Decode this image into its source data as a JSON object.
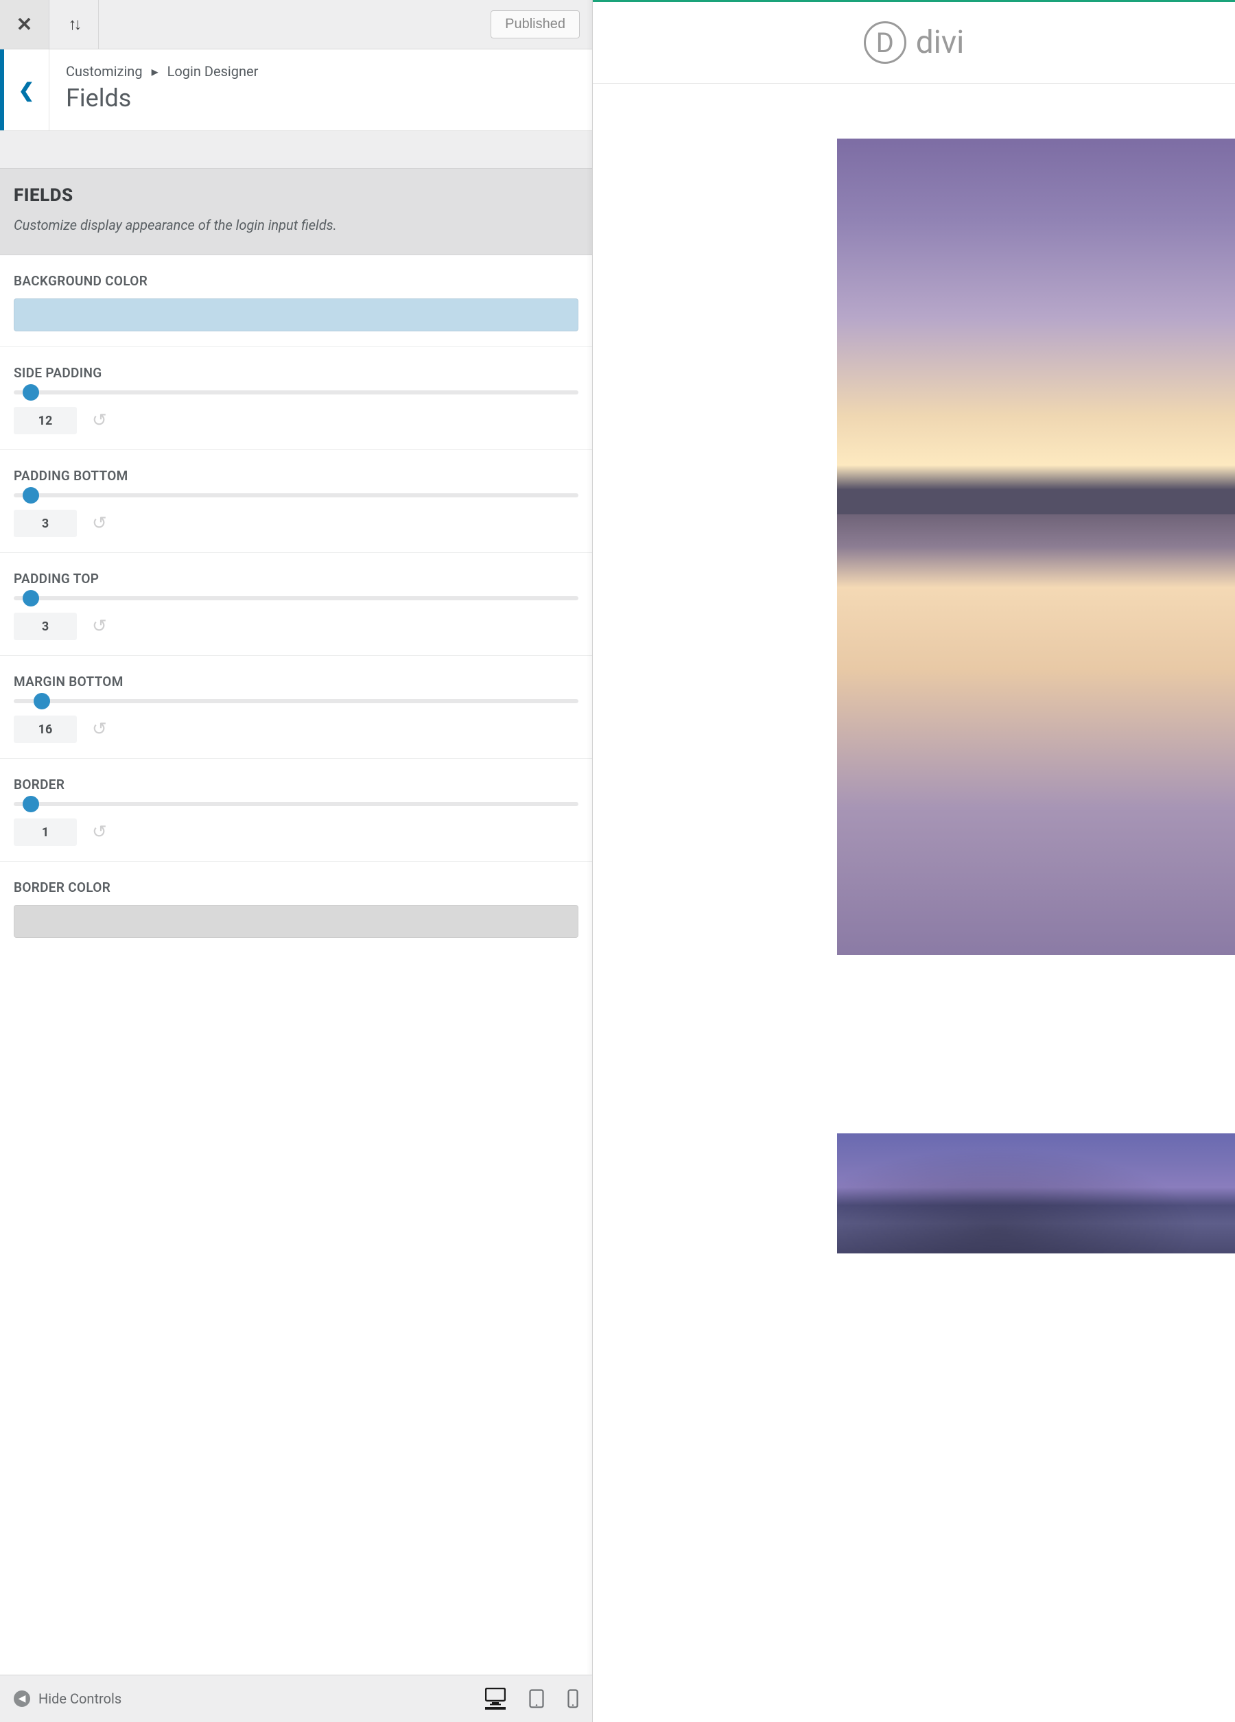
{
  "topbar": {
    "publish_label": "Published"
  },
  "header": {
    "crumb_root": "Customizing",
    "crumb_sep": "▸",
    "crumb_section": "Login Designer",
    "title": "Fields"
  },
  "description": {
    "heading": "FIELDS",
    "text": "Customize display appearance of the login input fields."
  },
  "controls": {
    "bg_color_label": "BACKGROUND COLOR",
    "bg_color_value": "#bfdaea",
    "side_padding_label": "SIDE PADDING",
    "side_padding_value": "12",
    "padding_bottom_label": "PADDING BOTTOM",
    "padding_bottom_value": "3",
    "padding_top_label": "PADDING TOP",
    "padding_top_value": "3",
    "margin_bottom_label": "MARGIN BOTTOM",
    "margin_bottom_value": "16",
    "border_label": "BORDER",
    "border_value": "1",
    "border_color_label": "BORDER COLOR",
    "border_color_value": "#d9d9d9"
  },
  "footer": {
    "hide_controls_label": "Hide Controls"
  },
  "preview": {
    "brand_mark": "D",
    "brand_name": "divi"
  }
}
